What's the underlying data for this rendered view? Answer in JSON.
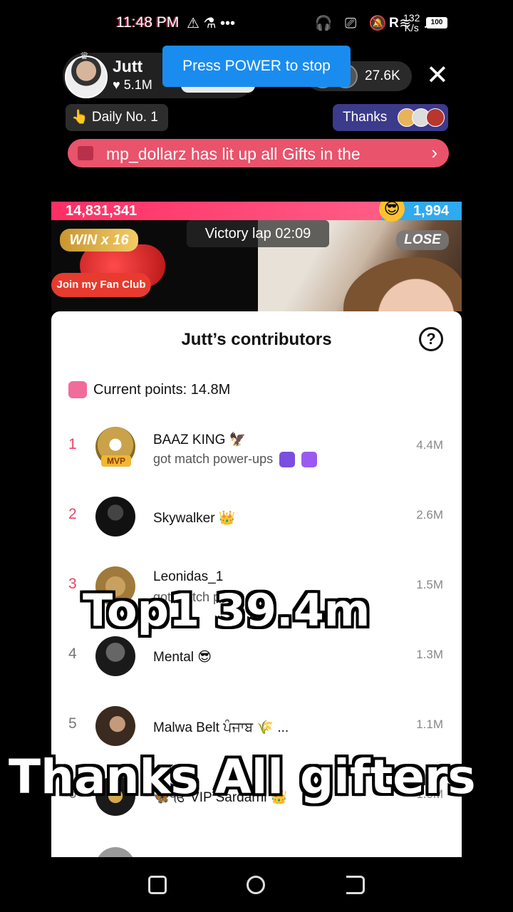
{
  "status_bar": {
    "time": "11:48 PM",
    "icons_left": "⚠ ⚗ •••",
    "icons_right": "🎧 ⎚ 🔕 ≋ .ıl",
    "network_letter": "R",
    "speed_value": "132",
    "speed_unit": "K/s",
    "battery": "100"
  },
  "live": {
    "host_name": "Jutt",
    "host_likes": "♥ 5.1M",
    "toast": "Press POWER to stop",
    "viewer_count": "27.6K",
    "close_icon": "✕",
    "daily_rank": "👆 Daily No. 1",
    "thanks_label": "Thanks",
    "gift_banner": "mp_dollarz has lit up all Gifts in the",
    "gift_banner_chevron": "›"
  },
  "battle": {
    "score_left": "14,831,341",
    "score_right": "1,994",
    "emoji": "😎",
    "win_badge": "WIN x 16",
    "fan_club_button": "Join my Fan Club",
    "victory_lap": "Victory lap  02:09",
    "lose_badge": "LOSE"
  },
  "contributors": {
    "title": "Jutt’s contributors",
    "help_icon": "?",
    "current_points": "Current points: 14.8M",
    "rows": [
      {
        "rank": "1",
        "name": "BAAZ KING 🦅",
        "sub": "got match power-ups",
        "points": "4.4M",
        "mvp": "MVP"
      },
      {
        "rank": "2",
        "name": "Skywalker 👑",
        "sub": "",
        "points": "2.6M"
      },
      {
        "rank": "3",
        "name": "Leonidas_1",
        "sub": "got match pow",
        "points": "1.5M"
      },
      {
        "rank": "4",
        "name": "Mental 😎",
        "sub": "",
        "points": "1.3M"
      },
      {
        "rank": "5",
        "name": "Malwa Belt ਪੰਜਾਬ 🌾 ...",
        "sub": "",
        "points": "1.1M"
      },
      {
        "rank": "6",
        "name": "🦋ੴ VIP Sardarni 👑",
        "sub": "",
        "points": "1.0M"
      }
    ]
  },
  "overlays": {
    "top_text": "Top1  39.4m",
    "bottom_text": "Thanks All gifters"
  },
  "colors": {
    "accent_red": "#ff2e63",
    "accent_blue": "#2eaaf0",
    "toast_blue": "#1a8cf0",
    "rank_pink": "#f0406a"
  }
}
